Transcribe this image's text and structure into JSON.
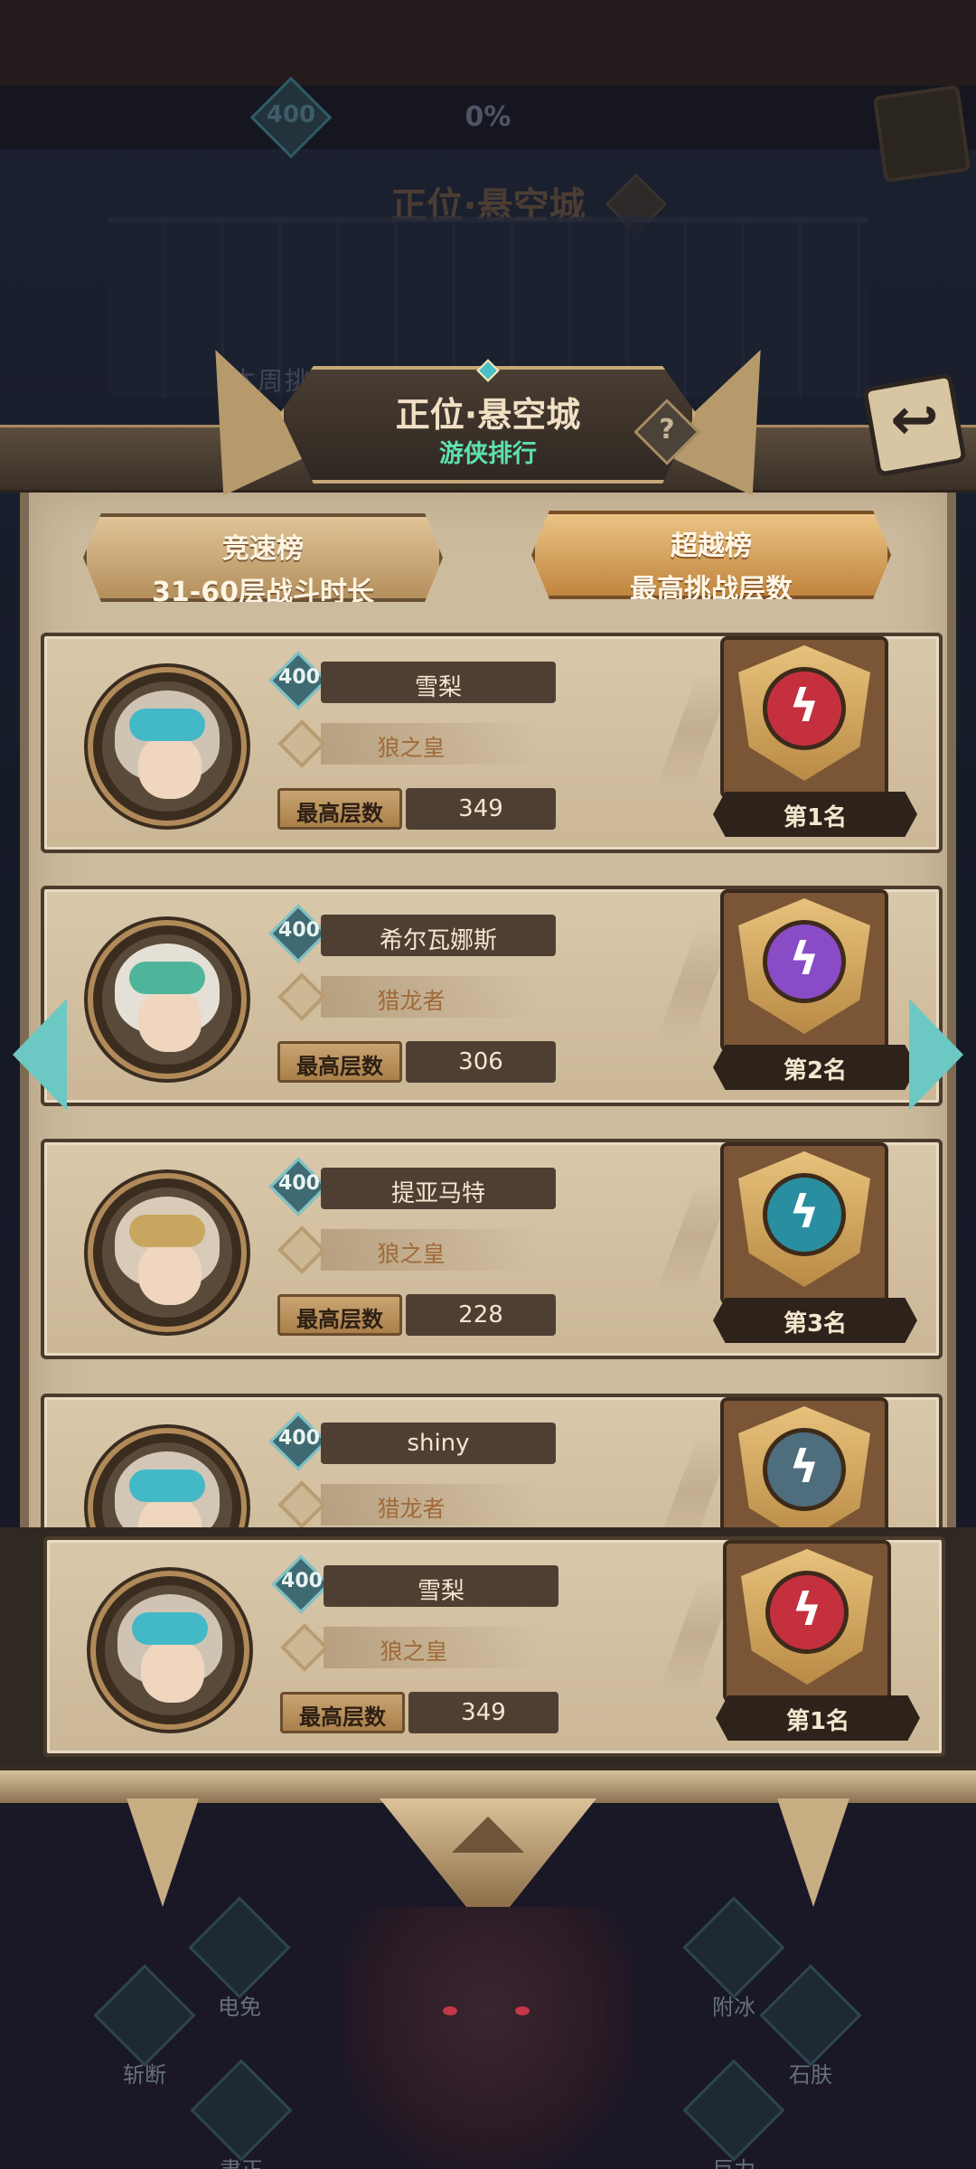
{
  "background": {
    "power_value": "400",
    "progress_percent": "0%",
    "title": "正位·悬空城",
    "help_glyph": "?",
    "week_text": "本周挑战进度　　　　时间总计"
  },
  "header": {
    "title": "正位·悬空城",
    "subtitle": "游侠排行",
    "help_glyph": "?",
    "back_glyph": "↩"
  },
  "tabs": [
    {
      "title": "竞速榜",
      "subtitle": "31-60层战斗时长",
      "selected": false
    },
    {
      "title": "超越榜",
      "subtitle": "最高挑战层数",
      "selected": true
    }
  ],
  "floor_label": "最高层数",
  "ranking": [
    {
      "level": "400",
      "name": "雪梨",
      "title": "狼之皇",
      "floor": "349",
      "rank": "第1名",
      "medal_color": "#c5303f",
      "hair": "#cfc4b4",
      "mask": "#43b9c8"
    },
    {
      "level": "400",
      "name": "希尔瓦娜斯",
      "title": "猎龙者",
      "floor": "306",
      "rank": "第2名",
      "medal_color": "#8a4bc7",
      "hair": "#e4e0d6",
      "mask": "#4fb59a"
    },
    {
      "level": "400",
      "name": "提亚马特",
      "title": "狼之皇",
      "floor": "228",
      "rank": "第3名",
      "medal_color": "#2a8ea1",
      "hair": "#d8cbb8",
      "mask": "#c8a65f"
    },
    {
      "level": "400",
      "name": "shiny",
      "title": "猎龙者",
      "floor": "",
      "rank": "",
      "medal_color": "#4e6d7d",
      "hair": "#d2c6b6",
      "mask": "#43b9c8"
    }
  ],
  "self_entry": {
    "level": "400",
    "name": "雪梨",
    "title": "狼之皇",
    "floor": "349",
    "rank": "第1名",
    "medal_color": "#c5303f",
    "hair": "#cfc4b4",
    "mask": "#43b9c8"
  },
  "skills": [
    {
      "label": "电免"
    },
    {
      "label": "斩断"
    },
    {
      "label": "肃正"
    },
    {
      "label": "附冰"
    },
    {
      "label": "石肤"
    },
    {
      "label": "巨力"
    }
  ],
  "colors": {
    "accent_teal": "#6cc8c2",
    "subtitle_green": "#5de1b0",
    "panel_parchment": "#cdbb9e"
  }
}
